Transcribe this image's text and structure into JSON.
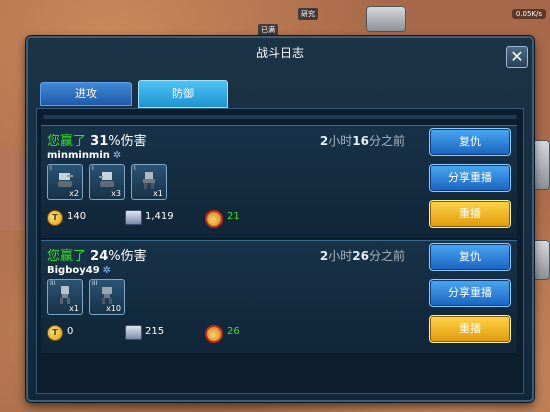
{
  "hud": {
    "top_label_1": "研究",
    "top_label_2": "已满",
    "network": "0.05K/s"
  },
  "dialog": {
    "title": "战斗日志",
    "close_glyph": "✕"
  },
  "tabs": [
    {
      "label": "进攻",
      "active": false
    },
    {
      "label": "防御",
      "active": true
    }
  ],
  "buttons": {
    "revenge": "复仇",
    "share": "分享重播",
    "replay": "重播"
  },
  "entries": [
    {
      "result_text": "您赢了",
      "percent": "31",
      "percent_suffix": "%伤害",
      "player": "minminmin",
      "time_h": "2",
      "time_h_unit": "小时",
      "time_m": "16",
      "time_m_unit": "分之前",
      "troops": [
        {
          "rank": "I",
          "qty": "x2",
          "icon": "tank-robot-icon"
        },
        {
          "rank": "I",
          "qty": "x3",
          "icon": "tank-robot-icon"
        },
        {
          "rank": "I",
          "qty": "x1",
          "icon": "mech-robot-icon"
        }
      ],
      "gold": "140",
      "alloy": "1,419",
      "medals": "21"
    },
    {
      "result_text": "您赢了",
      "percent": "24",
      "percent_suffix": "%伤害",
      "player": "Bigboy49",
      "time_h": "2",
      "time_h_unit": "小时",
      "time_m": "26",
      "time_m_unit": "分之前",
      "troops": [
        {
          "rank": "III",
          "qty": "x1",
          "icon": "walker-robot-icon"
        },
        {
          "rank": "III",
          "qty": "x10",
          "icon": "walker-robot-icon"
        }
      ],
      "gold": "0",
      "alloy": "215",
      "medals": "26"
    }
  ],
  "colors": {
    "win_green": "#39e02a",
    "button_blue": "#1a63c0",
    "button_gold": "#e09a0a"
  }
}
